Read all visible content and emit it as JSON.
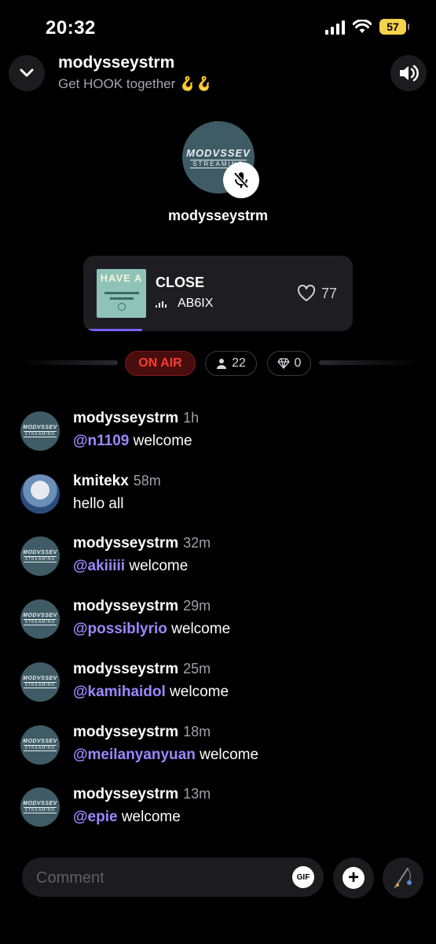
{
  "status": {
    "time": "20:32",
    "battery": "57"
  },
  "header": {
    "title": "modysseystrm",
    "subtitle": "Get HOOK together 🪝🪝"
  },
  "host": {
    "logo_top": "MODVSSEV",
    "logo_bottom": "STREAMING",
    "name": "modysseystrm"
  },
  "song": {
    "cover_text": "HAVE A",
    "title": "CLOSE",
    "artist": "AB6IX",
    "likes": "77",
    "progress": 0.2
  },
  "room": {
    "status": "ON AIR",
    "listeners": "22",
    "gems": "0"
  },
  "messages": [
    {
      "user": "modysseystrm",
      "time": "1h",
      "mention": "@n1109",
      "text": " welcome",
      "avatar": "logo"
    },
    {
      "user": "kmitekx",
      "time": "58m",
      "mention": "",
      "text": "hello all",
      "avatar": "photo"
    },
    {
      "user": "modysseystrm",
      "time": "32m",
      "mention": "@akiiiii",
      "text": " welcome",
      "avatar": "logo"
    },
    {
      "user": "modysseystrm",
      "time": "29m",
      "mention": "@possiblyrio",
      "text": " welcome",
      "avatar": "logo"
    },
    {
      "user": "modysseystrm",
      "time": "25m",
      "mention": "@kamihaidol",
      "text": " welcome",
      "avatar": "logo"
    },
    {
      "user": "modysseystrm",
      "time": "18m",
      "mention": "@meilanyanyuan",
      "text": " welcome",
      "avatar": "logo"
    },
    {
      "user": "modysseystrm",
      "time": "13m",
      "mention": "@epie",
      "text": " welcome",
      "avatar": "logo"
    }
  ],
  "composer": {
    "placeholder": "Comment",
    "gif_label": "GIF",
    "plus_label": "+"
  },
  "colors": {
    "accent": "#9d87ff",
    "onair": "#ff3b30",
    "battery": "#f4d24a"
  }
}
